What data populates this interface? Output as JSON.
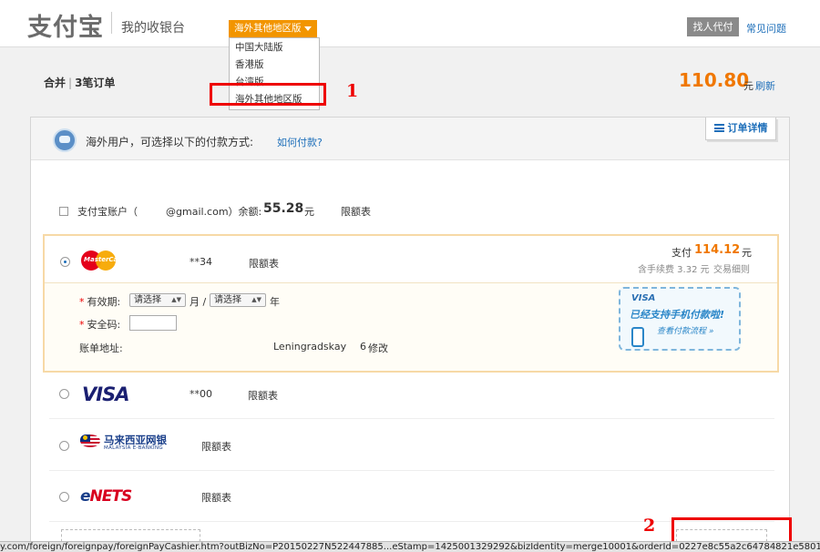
{
  "header": {
    "logo_text": "支付宝",
    "cashier_title": "我的收银台",
    "region_button": "海外其他地区版",
    "region_options": [
      "中国大陆版",
      "香港版",
      "台湾版",
      "海外其他地区版"
    ],
    "agent_button": "找人代付",
    "faq_link": "常见问题"
  },
  "order": {
    "prefix": "合并",
    "count_label": "3笔订单",
    "total": "110.80",
    "unit": "元",
    "refresh": "刷新"
  },
  "annotations": {
    "one": "1",
    "two": "2"
  },
  "panel": {
    "heading": "海外用户，可选择以下的付款方式:",
    "howto_link": "如何付款?",
    "details_tab": "订单详情"
  },
  "alipay_account": {
    "label": "支付宝账户（",
    "email": "@gmail.com）余额:",
    "balance": "55.28",
    "unit": "元",
    "limit_link": "限额表"
  },
  "mastercard": {
    "logo_text": "MasterCard",
    "masked": "**34",
    "limit_link": "限额表",
    "pay_label": "支付",
    "pay_amount": "114.12",
    "pay_unit": "元",
    "fee_text": "含手续费 3.32 元",
    "fee_link": "交易细则",
    "expiry_label": "有效期:",
    "month_select": "请选择",
    "month_unit": "月 /",
    "year_select": "请选择",
    "year_unit": "年",
    "cvv_label": "安全码:",
    "billing_label": "账单地址:",
    "billing_value": "Leningradskay",
    "billing_num": "6",
    "edit_link": "修改"
  },
  "promo": {
    "brand": "VISA",
    "line1": "已经支持手机付款啦!",
    "line2": "查看付款流程 »"
  },
  "visa": {
    "logo_text": "VISA",
    "masked": "**00",
    "limit_link": "限额表"
  },
  "malaysia": {
    "name": "马来西亚网银",
    "subtitle": "MALAYSIA E-BANKING",
    "limit_link": "限额表"
  },
  "enets": {
    "logo_prefix": "e",
    "logo_main": "NETS",
    "limit_link": "限额表"
  },
  "status_url": "y.com/foreign/foreignpay/foreignPayCashier.htm?outBizNo=P20150227N522447885...eStamp=1425001329292&bizIdentity=merge10001&orderId=0227e8c55a2c64784821e5801286885"
}
